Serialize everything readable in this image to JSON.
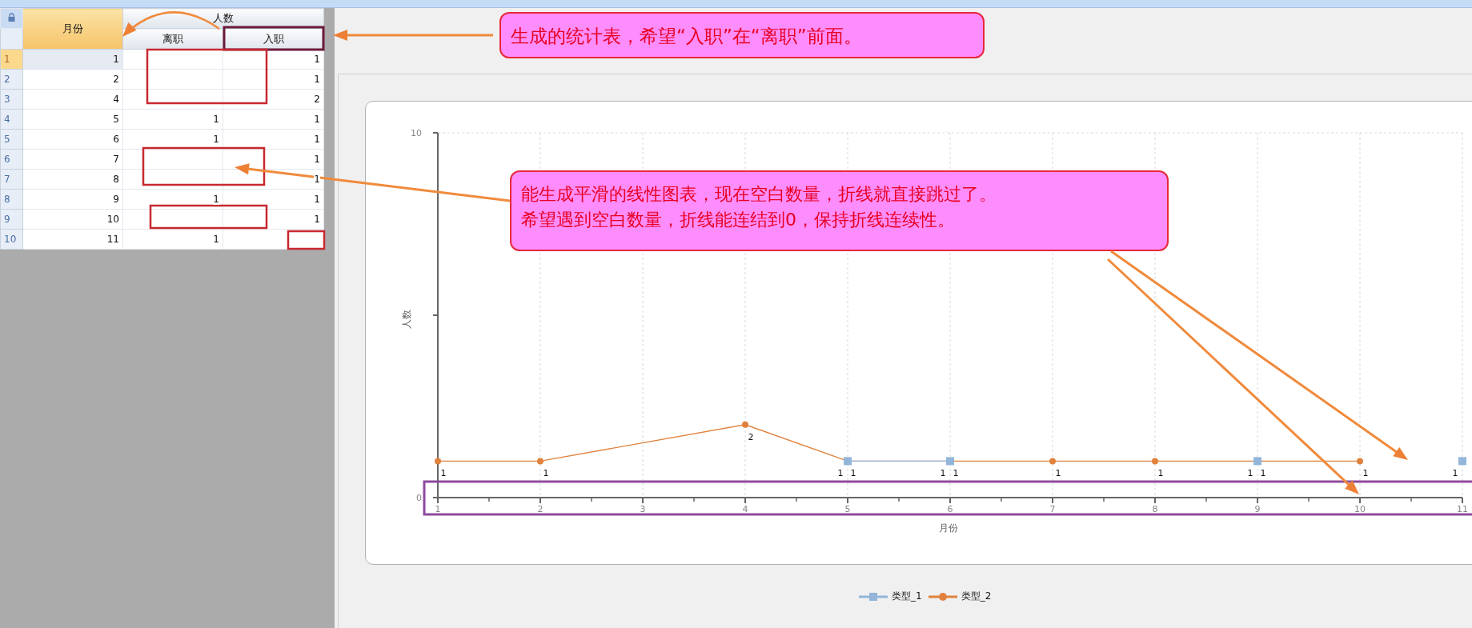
{
  "table": {
    "month_column": {
      "label": "月份",
      "selected": true
    },
    "group": {
      "label": "人数",
      "columns": [
        {
          "label": "离职",
          "selected": false
        },
        {
          "label": "入职",
          "selected": false
        }
      ]
    },
    "rows": [
      {
        "number": "1",
        "month": "1",
        "hired": "1",
        "selected": true
      },
      {
        "number": "2",
        "month": "2",
        "hired": "1",
        "selected": false
      },
      {
        "number": "3",
        "month": "4",
        "hired": "2",
        "selected": false
      },
      {
        "number": "4",
        "month": "5",
        "resigned": "1",
        "hired": "1",
        "selected": false
      },
      {
        "number": "5",
        "month": "6",
        "resigned": "1",
        "hired": "1",
        "selected": false
      },
      {
        "number": "6",
        "month": "7",
        "hired": "1",
        "selected": false
      },
      {
        "number": "7",
        "month": "8",
        "hired": "1",
        "selected": false
      },
      {
        "number": "8",
        "month": "9",
        "resigned": "1",
        "hired": "1",
        "selected": false
      },
      {
        "number": "9",
        "month": "10",
        "hired": "1",
        "selected": false
      },
      {
        "number": "10",
        "month": "11",
        "resigned": "1",
        "selected": false
      }
    ]
  },
  "chart": {
    "chart_data": {
      "type": "line",
      "xlabel": "月份",
      "ylabel": "人数",
      "x": [
        1,
        2,
        4,
        5,
        6,
        7,
        8,
        9,
        10,
        11
      ],
      "xlim": [
        1,
        11
      ],
      "ylim": [
        0,
        10
      ],
      "xticks": [
        1,
        2,
        3,
        4,
        5,
        6,
        7,
        8,
        9,
        10,
        11
      ],
      "yticks": [
        0,
        10
      ],
      "data_labels": true,
      "grid": true,
      "series": [
        {
          "name": "类型_1",
          "color": "#93b5d9",
          "marker": "square",
          "values": [
            null,
            null,
            null,
            1,
            1,
            null,
            null,
            1,
            null,
            1
          ]
        },
        {
          "name": "类型_2",
          "color": "#e0823d",
          "marker": "circle",
          "values": [
            1,
            1,
            2,
            1,
            1,
            1,
            1,
            1,
            1,
            null
          ]
        }
      ]
    }
  },
  "callouts": [
    {
      "lines": [
        "生成的统计表，希望“入职”在“离职”前面。"
      ]
    },
    {
      "lines": [
        "能生成平滑的线性图表，现在空白数量，折线就直接跳过了。",
        "希望遇到空白数量，折线能连结到0，保持折线连续性。"
      ]
    }
  ]
}
